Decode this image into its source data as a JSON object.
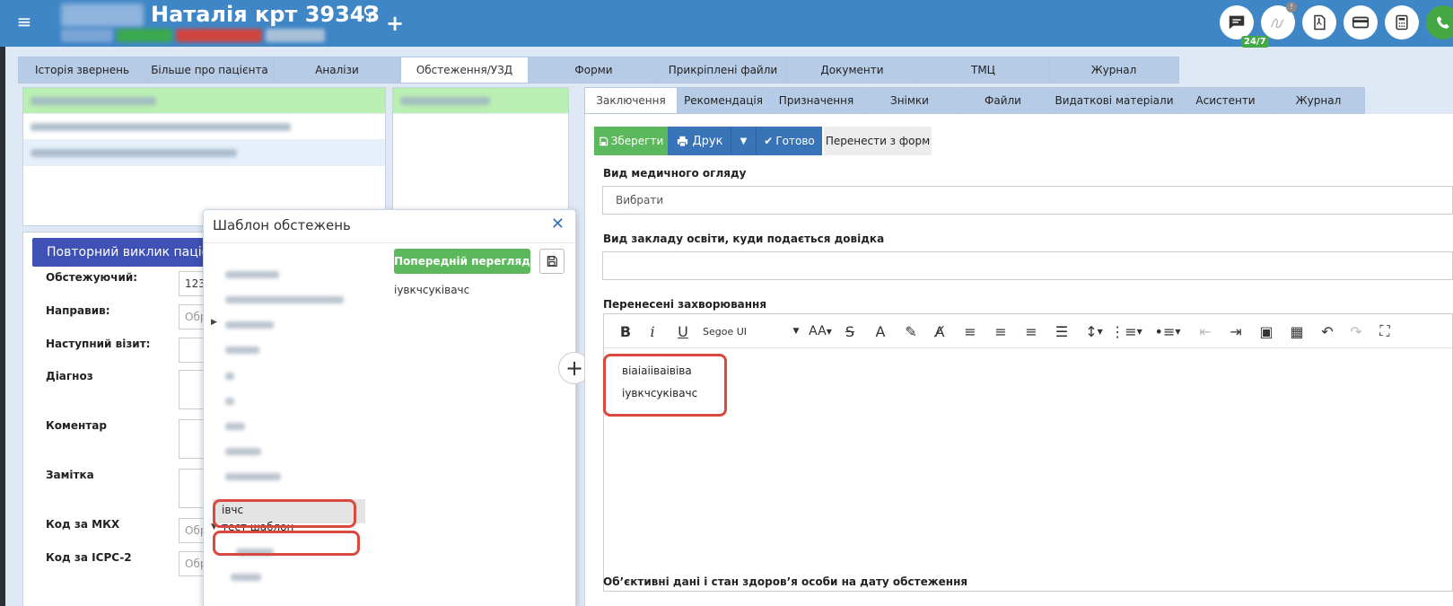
{
  "header": {
    "patient_name": "Наталія крт 39343",
    "gender_symbol": "♀",
    "add_symbol": "+",
    "chat_badge": "24/7",
    "colors": {
      "bar": "#3f86c6",
      "accent_green": "#44a845"
    }
  },
  "main_tabs": [
    {
      "label": "Історія звернень",
      "active": false
    },
    {
      "label": "Більше про пацієнта",
      "active": false
    },
    {
      "label": "Аналізи",
      "active": false
    },
    {
      "label": "Обстеження/УЗД",
      "active": true
    },
    {
      "label": "Форми",
      "active": false
    },
    {
      "label": "Прикріплені файли",
      "active": false
    },
    {
      "label": "Документи",
      "active": false
    },
    {
      "label": "ТМЦ",
      "active": false
    },
    {
      "label": "Журнал",
      "active": false
    }
  ],
  "left_form": {
    "repeat_button": "Повторний виклик пацієнта",
    "fields": [
      {
        "label": "Обстежуючий:",
        "value": "123"
      },
      {
        "label": "Направив:",
        "placeholder": "Обр"
      },
      {
        "label": "Наступний візит:",
        "placeholder": ""
      },
      {
        "label": "Діагноз",
        "placeholder": ""
      },
      {
        "label": "Коментар",
        "placeholder": ""
      },
      {
        "label": "Замітка",
        "placeholder": ""
      },
      {
        "label": "Код за МКХ",
        "placeholder": "Обр"
      },
      {
        "label": "Код за ICPC-2",
        "placeholder": "Обр"
      }
    ]
  },
  "popup": {
    "title": "Шаблон обстежень",
    "close_symbol": "✕",
    "preview_button": "Попередній перегляд",
    "preview_text": "іувкчсуківачс",
    "tree": {
      "selected_item": "івчс",
      "folder_item": "тест шаблон"
    }
  },
  "right_tabs": [
    {
      "label": "Заключення",
      "active": true
    },
    {
      "label": "Рекомендація",
      "active": false
    },
    {
      "label": "Призначення",
      "active": false
    },
    {
      "label": "Знімки",
      "active": false
    },
    {
      "label": "Файли",
      "active": false
    },
    {
      "label": "Видаткові матеріали",
      "active": false
    },
    {
      "label": "Асистенти",
      "active": false
    },
    {
      "label": "Журнал",
      "active": false
    }
  ],
  "actions": {
    "save": "Зберегти",
    "print": "Друк",
    "ready": "Готово",
    "transfer": "Перенести з форм"
  },
  "form": {
    "exam_type_label": "Вид медичного огляду",
    "exam_type_value": "Вибрати",
    "school_label": "Вид закладу освіти, куди подається довідка",
    "school_value": "",
    "diseases_label": "Перенесені захворювання",
    "editor_font": "Segoe UI",
    "editor_lines": [
      "віаіаііваівіва",
      "іувкчсуківачс"
    ],
    "objective_label": "Об’єктивні дані і стан здоров’я особи на дату обстеження"
  }
}
